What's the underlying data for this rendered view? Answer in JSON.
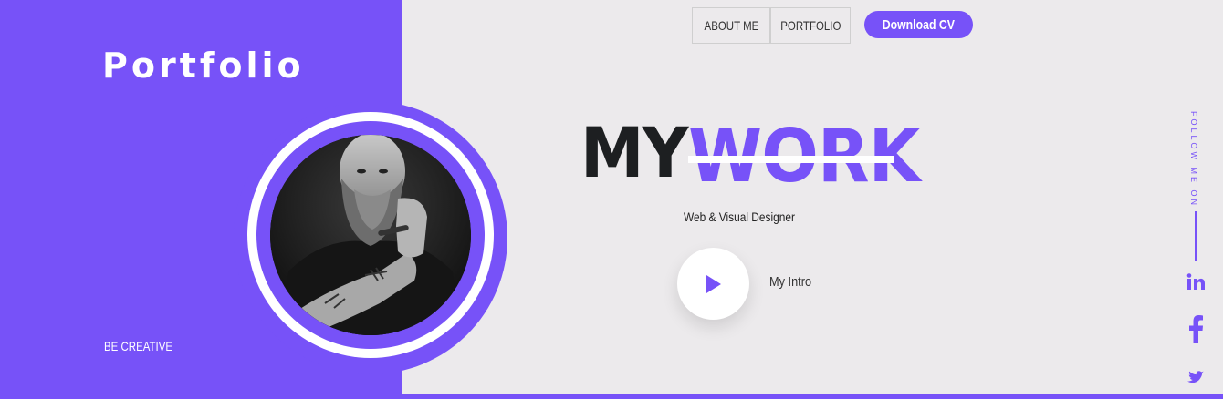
{
  "brand": {
    "title": "Portfolio",
    "tagline": "BE CREATIVE"
  },
  "nav": {
    "about": "ABOUT ME",
    "portfolio": "PORTFOLIO",
    "cv": "Download CV"
  },
  "hero": {
    "word1": "MY",
    "word2": "WORK",
    "subtitle": "Web & Visual Designer",
    "intro_label": "My Intro"
  },
  "social": {
    "follow_text": "FOLLOW ME ON",
    "icons": [
      "linkedin-icon",
      "facebook-icon",
      "twitter-icon"
    ]
  },
  "colors": {
    "accent": "#7752f8",
    "background": "#eceaec",
    "dark": "#1d1f21"
  }
}
